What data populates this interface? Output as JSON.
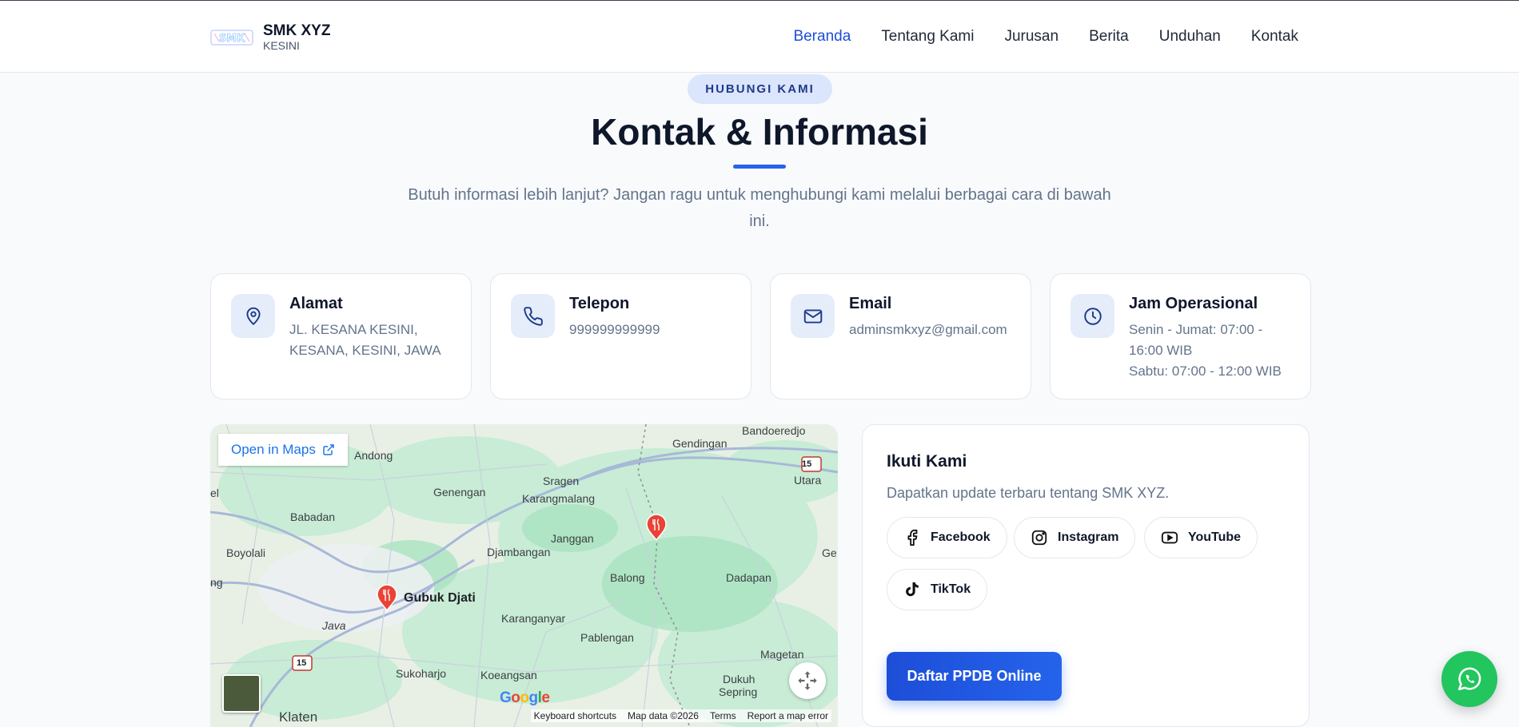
{
  "header": {
    "logo_name": "SMK XYZ",
    "logo_sub": "KESINI",
    "nav": [
      "Beranda",
      "Tentang Kami",
      "Jurusan",
      "Berita",
      "Unduhan",
      "Kontak"
    ],
    "active_nav": "Beranda"
  },
  "section": {
    "badge": "HUBUNGI KAMI",
    "title": "Kontak & Informasi",
    "subtitle": "Butuh informasi lebih lanjut? Jangan ragu untuk menghubungi kami melalui berbagai cara di bawah ini."
  },
  "cards": [
    {
      "icon": "location-pin-icon",
      "title": "Alamat",
      "lines": [
        "JL. KESANA KESINI, KESANA, KESINI, JAWA"
      ]
    },
    {
      "icon": "phone-icon",
      "title": "Telepon",
      "lines": [
        "999999999999"
      ]
    },
    {
      "icon": "mail-icon",
      "title": "Email",
      "lines": [
        "adminsmkxyz@gmail.com"
      ]
    },
    {
      "icon": "clock-icon",
      "title": "Jam Operasional",
      "lines": [
        "Senin - Jumat: 07:00 - 16:00 WIB",
        "Sabtu: 07:00 - 12:00 WIB"
      ]
    }
  ],
  "map": {
    "open_label": "Open in Maps",
    "labels": {
      "bandoeredjo": "Bandoeredjo",
      "gendingan": "Gendingan",
      "andong": "Andong",
      "utara": "Utara",
      "sragen": "Sragen",
      "genengan": "Genengan",
      "karangmalang": "Karangmalang",
      "babadan": "Babadan",
      "janggan": "Janggan",
      "boyolali": "Boyolali",
      "djambangan": "Djambangan",
      "ge": "Ge",
      "balong": "Balong",
      "dadapan": "Dadapan",
      "ng": "ng",
      "el": "el",
      "gubuk": "Gubuk Djati",
      "karanganyar": "Karanganyar",
      "java": "Java",
      "pablengan": "Pablengan",
      "magetan": "Magetan",
      "sukoharjo": "Sukoharjo",
      "koeangsan": "Koeangsan",
      "dukuh": "Dukuh",
      "sepring": "Sepring",
      "klaten": "Klaten",
      "road15": "15"
    },
    "attribution": [
      "Keyboard shortcuts",
      "Map data ©2026",
      "Terms",
      "Report a map error"
    ],
    "google": "Google"
  },
  "social": {
    "title": "Ikuti Kami",
    "desc": "Dapatkan update terbaru tentang SMK XYZ.",
    "buttons": [
      "Facebook",
      "Instagram",
      "YouTube",
      "TikTok"
    ],
    "ppdb": "Daftar PPDB Online"
  },
  "colors": {
    "accent": "#2563eb",
    "whatsapp": "#22c55e"
  }
}
